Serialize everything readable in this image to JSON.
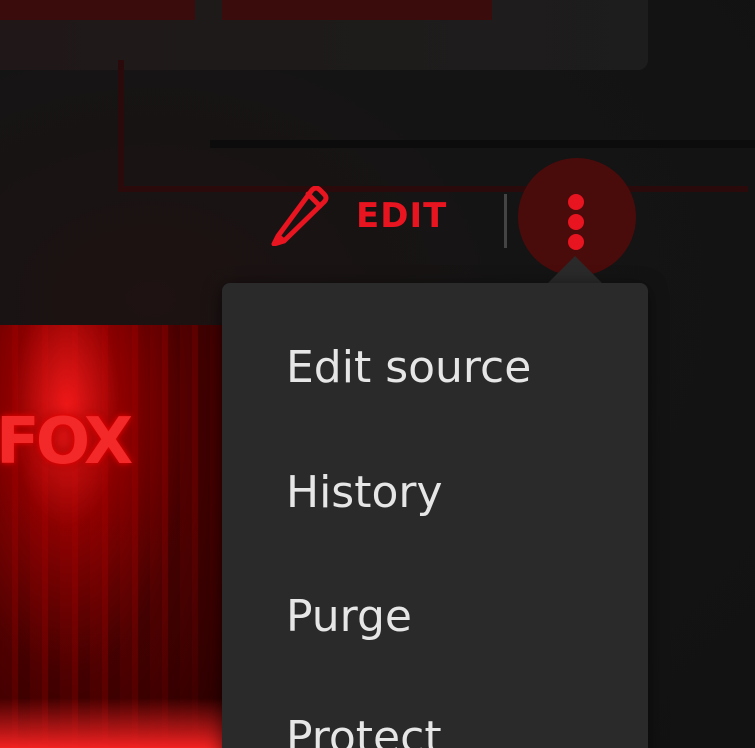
{
  "page_actions": {
    "edit_label": "EDIT",
    "edit_icon": "pencil-icon",
    "more_icon": "more-vertical-icon",
    "accent_color": "#e8141f"
  },
  "dropdown": {
    "items": [
      {
        "label": "Edit source"
      },
      {
        "label": "History"
      },
      {
        "label": "Purge"
      },
      {
        "label": "Protect"
      }
    ]
  },
  "background_image": {
    "caption": "FOX"
  }
}
